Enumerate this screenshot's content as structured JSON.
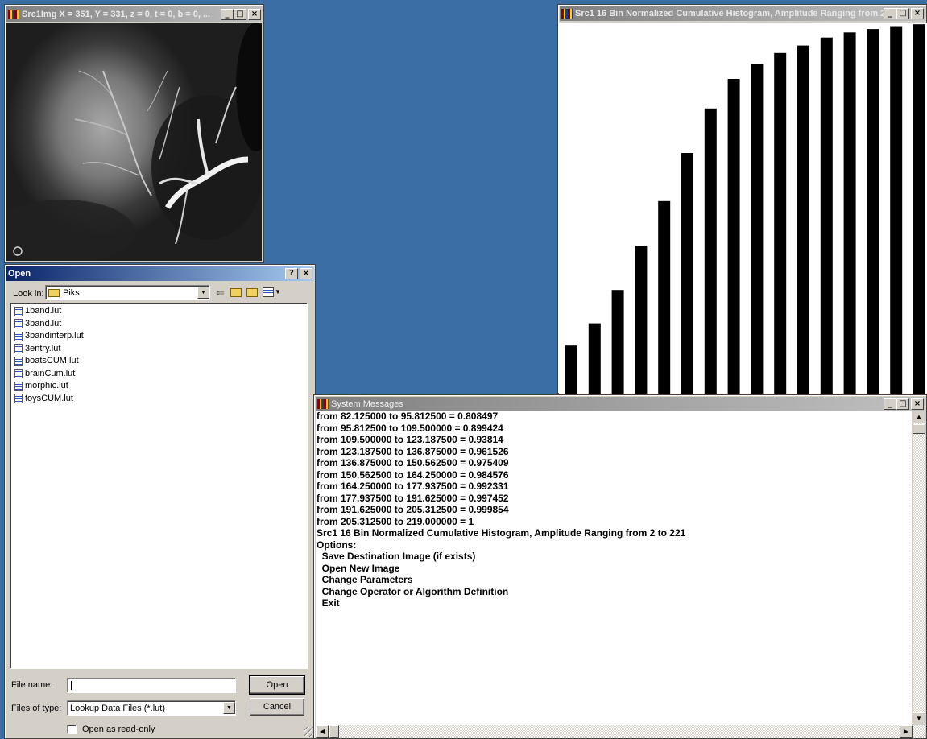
{
  "image_window": {
    "title": "Src1Img  X = 351, Y = 331, z = 0, t = 0, b = 0, ..."
  },
  "histogram_window": {
    "title": "Src1 16 Bin Normalized Cumulative Histogram, Amplitude Ranging from 2 to..."
  },
  "open_dialog": {
    "title": "Open",
    "look_in_label": "Look in:",
    "look_in_value": "Piks",
    "files": [
      "1band.lut",
      "3band.lut",
      "3bandinterp.lut",
      "3entry.lut",
      "boatsCUM.lut",
      "brainCum.lut",
      "morphic.lut",
      "toysCUM.lut"
    ],
    "file_name_label": "File name:",
    "file_name_value": "",
    "files_of_type_label": "Files of type:",
    "files_of_type_value": "Lookup Data Files (*.lut)",
    "open_button": "Open",
    "cancel_button": "Cancel",
    "readonly_label": "Open as read-only"
  },
  "messages_window": {
    "title": "System Messages",
    "lines": [
      "from 82.125000 to 95.812500 = 0.808497",
      "from 95.812500 to 109.500000 = 0.899424",
      "from 109.500000 to 123.187500 = 0.93814",
      "from 123.187500 to 136.875000 = 0.961526",
      "from 136.875000 to 150.562500 = 0.975409",
      "from 150.562500 to 164.250000 = 0.984576",
      "from 164.250000 to 177.937500 = 0.992331",
      "from 177.937500 to 191.625000 = 0.997452",
      "from 191.625000 to 205.312500 = 0.999854",
      "from 205.312500 to 219.000000 = 1",
      "Src1 16 Bin Normalized Cumulative Histogram, Amplitude Ranging from 2 to 221",
      "Options:",
      "  Save Destination Image (if exists)",
      "  Open New Image",
      "  Change Parameters",
      "  Change Operator or Algorithm Definition",
      "  Exit"
    ]
  },
  "chart_data": {
    "type": "bar",
    "title": "Src1 16 Bin Normalized Cumulative Histogram, Amplitude Ranging from 2 to 221",
    "values": [
      0.13,
      0.19,
      0.28,
      0.4,
      0.52,
      0.65,
      0.77,
      0.85,
      0.89,
      0.92,
      0.94,
      0.961526,
      0.975409,
      0.984576,
      0.992331,
      0.997452
    ],
    "ylim": [
      0,
      1
    ],
    "grid": false,
    "colors": {
      "bar": "#000000",
      "background": "#ffffff"
    }
  }
}
